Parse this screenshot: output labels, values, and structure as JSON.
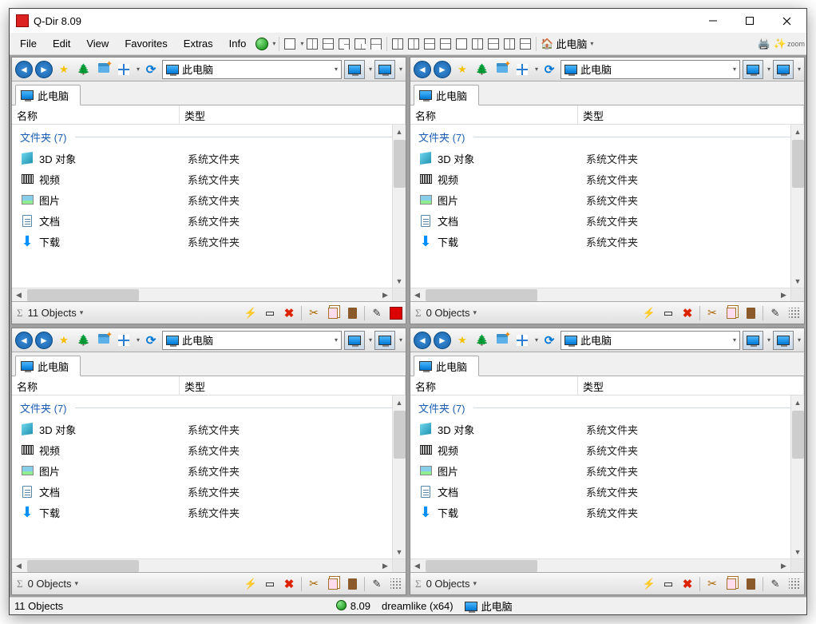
{
  "title": "Q-Dir 8.09",
  "menus": {
    "file": "File",
    "edit": "Edit",
    "view": "View",
    "favorites": "Favorites",
    "extras": "Extras",
    "info": "Info",
    "cipc": "此电脑"
  },
  "addr": "此电脑",
  "tab": "此电脑",
  "cols": {
    "name": "名称",
    "type": "类型"
  },
  "group": "文件夹 (7)",
  "sysfolder": "系统文件夹",
  "items": {
    "d3": "3D 对象",
    "vid": "视频",
    "pic": "图片",
    "doc": "文档",
    "dl": "下载"
  },
  "status": {
    "p1": "11 Objects",
    "p2": "0 Objects",
    "p3": "0 Objects",
    "p4": "0 Objects"
  },
  "footer": {
    "objects": "11 Objects",
    "ver": "8.09",
    "build": "dreamlike (x64)",
    "loc": "此电脑"
  }
}
